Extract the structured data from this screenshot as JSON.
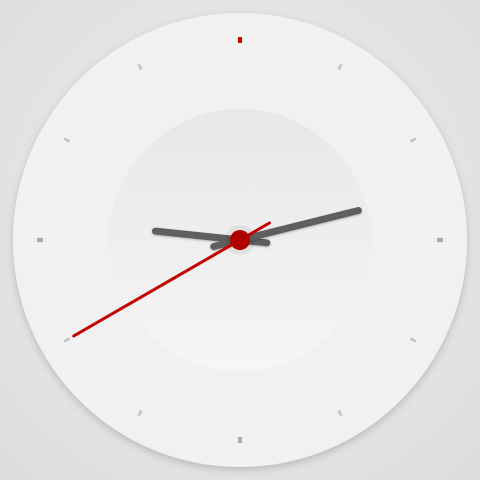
{
  "clock": {
    "time": {
      "hours": 9,
      "minutes": 12,
      "seconds": 40
    },
    "tick_count": 12,
    "colors": {
      "face": "#f1f1f1",
      "inner_dial_top": "#e7e7e7",
      "inner_dial_bottom": "#f6f6f6",
      "tick": "#c4c4c4",
      "tick_cardinal": "#a9a9a9",
      "tick_twelve": "#cc0000",
      "hand": "#5e5e5e",
      "second_hand": "#c40000",
      "center_cap": "#b00000"
    },
    "icons": {
      "hour_hand": "hour-hand-icon",
      "minute_hand": "minute-hand-icon",
      "second_hand": "second-hand-icon"
    }
  }
}
